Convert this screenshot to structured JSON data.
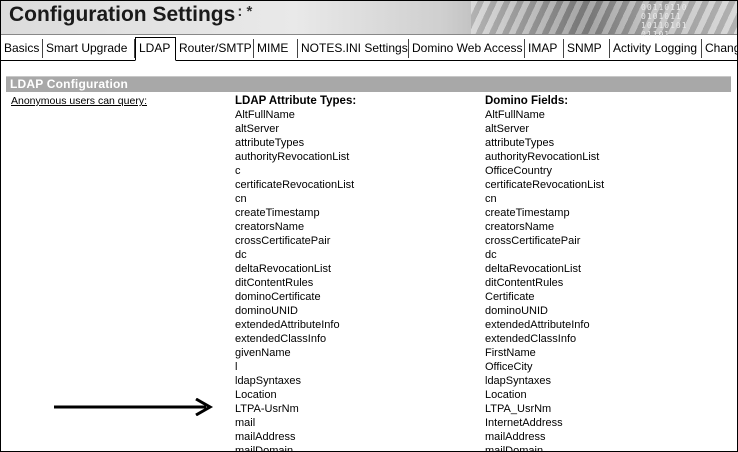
{
  "window": {
    "title": "Configuration Settings",
    "modified_mark": ": *",
    "header_binary": [
      "00110110",
      "0101011 ",
      "10110101",
      "01101  "
    ]
  },
  "tabs": [
    {
      "label": "Basics",
      "active": false
    },
    {
      "label": "Smart Upgrade",
      "active": false
    },
    {
      "label": "LDAP",
      "active": true
    },
    {
      "label": "Router/SMTP",
      "active": false
    },
    {
      "label": "MIME",
      "active": false
    },
    {
      "label": "NOTES.INI Settings",
      "active": false
    },
    {
      "label": "Domino Web Access",
      "active": false
    },
    {
      "label": "IMAP",
      "active": false
    },
    {
      "label": "SNMP",
      "active": false
    },
    {
      "label": "Activity Logging",
      "active": false
    },
    {
      "label": "Chang",
      "active": false
    }
  ],
  "section": {
    "title": "LDAP Configuration",
    "anonymous_label": "Anonymous users can query:",
    "ldap_header": "LDAP Attribute Types:",
    "domino_header": "Domino Fields:"
  },
  "ldap_attributes": [
    "AltFullName",
    "altServer",
    "attributeTypes",
    "authorityRevocationList",
    "c",
    "certificateRevocationList",
    "cn",
    "createTimestamp",
    "creatorsName",
    "crossCertificatePair",
    "dc",
    "deltaRevocationList",
    "ditContentRules",
    "dominoCertificate",
    "dominoUNID",
    "extendedAttributeInfo",
    "extendedClassInfo",
    "givenName",
    "l",
    "ldapSyntaxes",
    "Location",
    "LTPA-UsrNm",
    "mail",
    "mailAddress",
    "mailDomain"
  ],
  "domino_fields": [
    "AltFullName",
    "altServer",
    "attributeTypes",
    "authorityRevocationList",
    "OfficeCountry",
    "certificateRevocationList",
    "cn",
    "createTimestamp",
    "creatorsName",
    "crossCertificatePair",
    "dc",
    "deltaRevocationList",
    "ditContentRules",
    "Certificate",
    "dominoUNID",
    "extendedAttributeInfo",
    "extendedClassInfo",
    "FirstName",
    "OfficeCity",
    "ldapSyntaxes",
    "Location",
    "LTPA_UsrNm",
    "InternetAddress",
    "mailAddress",
    "mailDomain"
  ],
  "annotation": {
    "icon": "right-arrow-icon",
    "points_to": "LTPA-UsrNm"
  }
}
